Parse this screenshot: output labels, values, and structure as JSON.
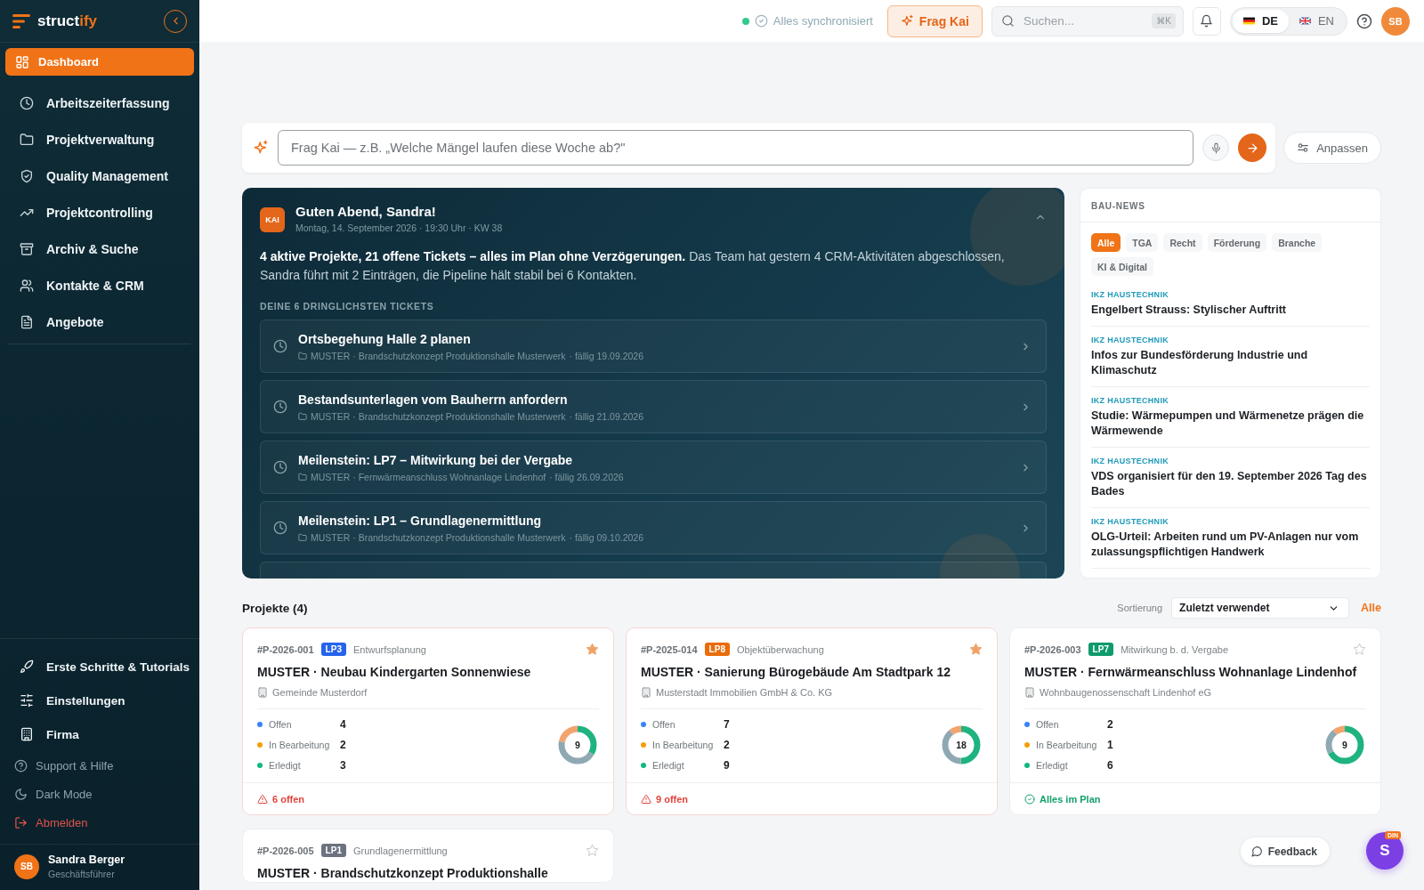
{
  "sidebar": {
    "logo": {
      "text": "struct",
      "accent": "ify"
    },
    "items": [
      {
        "label": "Dashboard",
        "selected": true
      },
      {
        "label": "Arbeitszeiterfassung",
        "selected": false
      },
      {
        "label": "Projektverwaltung",
        "selected": false
      },
      {
        "label": "Quality Management",
        "selected": false
      },
      {
        "label": "Projektcontrolling",
        "selected": false
      },
      {
        "label": "Archiv & Suche",
        "selected": false
      },
      {
        "label": "Kontakte & CRM",
        "selected": false
      },
      {
        "label": "Angebote",
        "selected": false
      }
    ],
    "bottom_items": [
      {
        "label": "Erste Schritte & Tutorials",
        "kind": "main"
      },
      {
        "label": "Einstellungen",
        "kind": "main"
      },
      {
        "label": "Firma",
        "kind": "main"
      },
      {
        "label": "Support & Hilfe",
        "kind": "minor"
      },
      {
        "label": "Dark Mode",
        "kind": "minor"
      },
      {
        "label": "Abmelden",
        "kind": "danger"
      }
    ],
    "user": {
      "initials": "SB",
      "name": "Sandra Berger",
      "role": "Geschäftsführer"
    }
  },
  "topbar": {
    "sync_status": "Alles synchronisiert",
    "ask_button": "Frag Kai",
    "search": {
      "placeholder": "Suchen...",
      "shortcut": "⌘K"
    },
    "languages": [
      {
        "code": "DE",
        "selected": true
      },
      {
        "code": "EN",
        "selected": false
      }
    ],
    "avatar": "SB"
  },
  "ask_bar": {
    "placeholder": "Frag Kai — z.B. „Welche Mängel laufen diese Woche ab?\"",
    "customize_button": "Anpassen"
  },
  "briefing": {
    "badge": "KAI",
    "greeting": "Guten Abend, Sandra!",
    "date": "Montag, 14. September 2026 · 19:30 Uhr · KW 38",
    "summary": "**4 aktive Projekte, 21 offene Tickets – alles im Plan ohne Verzögerungen.** Das Team hat gestern 4 CRM-Aktivitäten abgeschlossen, Sandra führt mit 2 Einträgen, die Pipeline hält stabil bei 6 Kontakten.",
    "tickets_heading": "DEINE 6 DRINGLICHSTEN TICKETS",
    "tickets": [
      {
        "title": "Ortsbegehung Halle 2 planen",
        "project": "MUSTER · Brandschutzkonzept Produktionshalle Musterwerk",
        "due": "· fällig 19.09.2026"
      },
      {
        "title": "Bestandsunterlagen vom Bauherrn anfordern",
        "project": "MUSTER · Brandschutzkonzept Produktionshalle Musterwerk",
        "due": "· fällig 21.09.2026"
      },
      {
        "title": "Meilenstein: LP7 – Mitwirkung bei der Vergabe",
        "project": "MUSTER · Fernwärmeanschluss Wohnanlage Lindenhof",
        "due": "· fällig 26.09.2026"
      },
      {
        "title": "Meilenstein: LP1 – Grundlagenermittlung",
        "project": "MUSTER · Brandschutzkonzept Produktionshalle Musterwerk",
        "due": "· fällig 09.10.2026"
      }
    ]
  },
  "news": {
    "title": "BAU-NEWS",
    "filters": [
      {
        "label": "Alle",
        "selected": true
      },
      {
        "label": "TGA",
        "selected": false
      },
      {
        "label": "Recht",
        "selected": false
      },
      {
        "label": "Förderung",
        "selected": false
      },
      {
        "label": "Branche",
        "selected": false
      },
      {
        "label": "KI & Digital",
        "selected": false
      }
    ],
    "items": [
      {
        "source": "IKZ HAUSTECHNIK",
        "title": "Engelbert Strauss: Stylischer Auftritt"
      },
      {
        "source": "IKZ HAUSTECHNIK",
        "title": "Infos zur Bundesförderung Industrie und Klimaschutz"
      },
      {
        "source": "IKZ HAUSTECHNIK",
        "title": "Studie: Wärmepumpen und Wärmenetze prägen die Wärmewende"
      },
      {
        "source": "IKZ HAUSTECHNIK",
        "title": "VDS organisiert für den 19. September 2026 Tag des Bades"
      },
      {
        "source": "IKZ HAUSTECHNIK",
        "title": "OLG-Urteil: Arbeiten rund um PV-Anlagen nur vom zulassungspflichtigen Handwerk"
      }
    ]
  },
  "projects": {
    "title": "Projekte (4)",
    "sort_label": "Sortierung",
    "sort_value": "Zuletzt verwendet",
    "all_link": "Alle",
    "items": [
      {
        "id": "#P-2026-001",
        "phase": "LP3",
        "color": "#2563eb",
        "phase_name": "Entwurfsplanung",
        "favorite": true,
        "title": "MUSTER · Neubau Kindergarten Sonnenwiese",
        "client": "Gemeinde Musterdorf",
        "stats": [
          {
            "label": "Offen",
            "value": "4",
            "color": "#3b82f6"
          },
          {
            "label": "In Bearbeitung",
            "value": "2",
            "color": "#f59e0b"
          },
          {
            "label": "Erledigt",
            "value": "3",
            "color": "#10b981"
          }
        ],
        "total": "9",
        "status": {
          "kind": "warning",
          "text": "6 offen"
        }
      },
      {
        "id": "#P-2025-014",
        "phase": "LP8",
        "color": "#ea6c0a",
        "phase_name": "Objektüberwachung",
        "favorite": true,
        "title": "MUSTER · Sanierung Bürogebäude Am Stadtpark 12",
        "client": "Musterstadt Immobilien GmbH & Co. KG",
        "stats": [
          {
            "label": "Offen",
            "value": "7",
            "color": "#3b82f6"
          },
          {
            "label": "In Bearbeitung",
            "value": "2",
            "color": "#f59e0b"
          },
          {
            "label": "Erledigt",
            "value": "9",
            "color": "#10b981"
          }
        ],
        "total": "18",
        "status": {
          "kind": "warning",
          "text": "9 offen"
        }
      },
      {
        "id": "#P-2026-003",
        "phase": "LP7",
        "color": "#0f9b6c",
        "phase_name": "Mitwirkung b. d. Vergabe",
        "favorite": false,
        "title": "MUSTER · Fernwärmeanschluss Wohnanlage Lindenhof",
        "client": "Wohnbaugenossenschaft Lindenhof eG",
        "stats": [
          {
            "label": "Offen",
            "value": "2",
            "color": "#3b82f6"
          },
          {
            "label": "In Bearbeitung",
            "value": "1",
            "color": "#f59e0b"
          },
          {
            "label": "Erledigt",
            "value": "6",
            "color": "#10b981"
          }
        ],
        "total": "9",
        "status": {
          "kind": "ok",
          "text": "Alles im Plan"
        }
      },
      {
        "id": "#P-2026-005",
        "phase": "LP1",
        "color": "#6b7280",
        "phase_name": "Grundlagenermittlung",
        "favorite": false,
        "title": "MUSTER · Brandschutzkonzept Produktionshalle"
      }
    ]
  },
  "feedback_button": "Feedback",
  "assistant_bubble": {
    "badge": "DIN",
    "letter": "S"
  }
}
